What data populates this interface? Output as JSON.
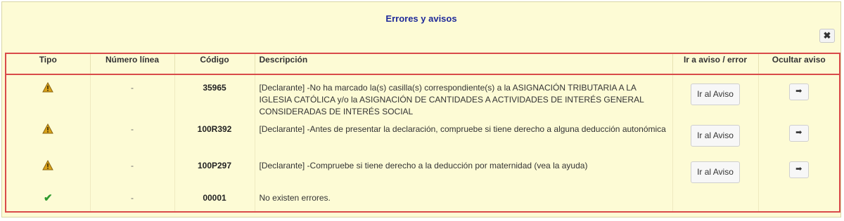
{
  "dialog": {
    "title": "Errores y avisos",
    "close_label": "✖"
  },
  "table": {
    "headers": {
      "tipo": "Tipo",
      "numero_linea": "Número línea",
      "codigo": "Código",
      "descripcion": "Descripción",
      "ir_aviso": "Ir a aviso / error",
      "ocultar": "Ocultar aviso"
    },
    "rows": [
      {
        "type": "warning",
        "line": "-",
        "code": "35965",
        "description": "[Declarante] -No ha marcado la(s) casilla(s) correspondiente(s) a la ASIGNACIÓN TRIBUTARIA A LA IGLESIA CATÓLICA y/o la ASIGNACIÓN DE CANTIDADES A ACTIVIDADES DE INTERÉS GENERAL CONSIDERADAS DE INTERÉS SOCIAL",
        "goto_label": "Ir al Aviso",
        "hide_label": "➡"
      },
      {
        "type": "warning",
        "line": "-",
        "code": "100R392",
        "description": "[Declarante] -Antes de presentar la declaración, compruebe si tiene derecho a alguna deducción autonómica",
        "goto_label": "Ir al Aviso",
        "hide_label": "➡"
      },
      {
        "type": "warning",
        "line": "-",
        "code": "100P297",
        "description": "[Declarante] -Compruebe si tiene derecho a la deducción por maternidad (vea la ayuda)",
        "goto_label": "Ir al Aviso",
        "hide_label": "➡"
      },
      {
        "type": "ok",
        "line": "-",
        "code": "00001",
        "description": "No existen errores.",
        "ok_glyph": "✔"
      }
    ]
  }
}
